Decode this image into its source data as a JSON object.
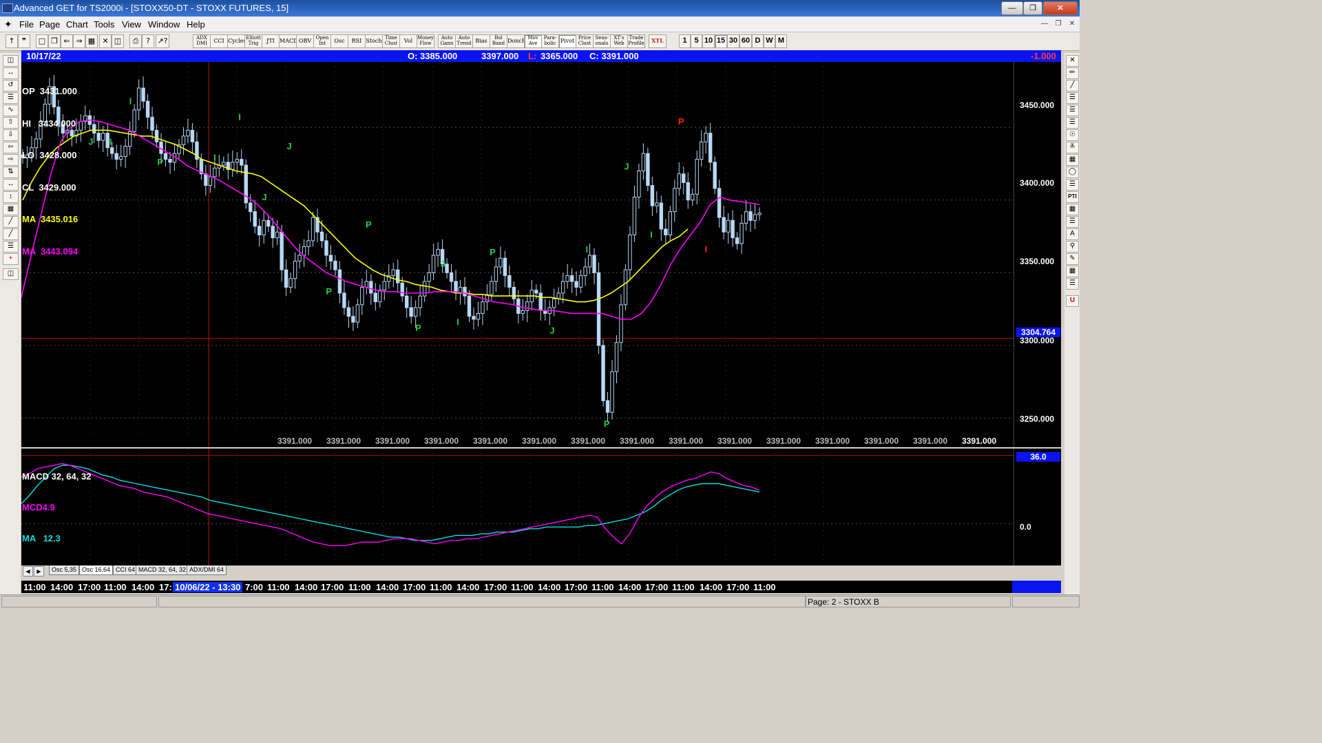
{
  "window": {
    "title": "Advanced GET for TS2000i - [STOXX50-DT - STOXX FUTURES, 15]"
  },
  "menu": [
    "File",
    "Page",
    "Chart",
    "Tools",
    "View",
    "Window",
    "Help"
  ],
  "toolbar": {
    "studies": [
      [
        "ADX",
        "DMI"
      ],
      [
        "CCI"
      ],
      [
        "Cycles"
      ],
      [
        "Elliott",
        "Trig"
      ],
      [
        "JTI"
      ],
      [
        "MACD"
      ],
      [
        "OBV"
      ],
      [
        "Open",
        "Int"
      ],
      [
        "Osc"
      ],
      [
        "RSI"
      ],
      [
        "Stoch"
      ],
      [
        "Time",
        "Clust"
      ],
      [
        "Vol"
      ],
      [
        "Money",
        "Flow"
      ],
      [
        "Auto",
        "Gann"
      ],
      [
        "Auto",
        "Trend"
      ],
      [
        "Bias"
      ],
      [
        "Bol",
        "Band"
      ],
      [
        "Donch"
      ],
      [
        "Mov",
        "Ave"
      ],
      [
        "Para-",
        "bolic"
      ],
      [
        "Pivot"
      ],
      [
        "Price",
        "Clust"
      ],
      [
        "Seas-",
        "onals"
      ],
      [
        "XT's",
        "Web"
      ],
      [
        "Trade",
        "Profile"
      ],
      [
        "XTL"
      ]
    ],
    "periods": [
      "1",
      "5",
      "10",
      "15",
      "30",
      "60",
      "D",
      "W",
      "M"
    ],
    "selected_period": "15"
  },
  "bar": {
    "date": "10/17/22",
    "open": "O: 3385.000",
    "high": "3397.000",
    "low_label": "L:",
    "low": "3365.000",
    "close": "C: 3391.000",
    "change": "-1.000"
  },
  "legend": {
    "op": "OP  3431.000",
    "hi": "HI   3434.000",
    "lo": "LO  3428.000",
    "cl": "CL  3429.000",
    "ma1": "MA  3435.016",
    "ma2": "MA  3443.094",
    "ma1_color": "#ffff00",
    "ma2_color": "#ff00ff"
  },
  "price_axis": [
    "3450.000",
    "3400.000",
    "3350.000",
    "3300.000",
    "3250.000"
  ],
  "crosshair_price": "3304.764",
  "flat_label": "3391.000",
  "macd": {
    "title": "MACD 32, 64, 32",
    "mcd": "MCD4.9",
    "ma": "MA   12.3",
    "axis_top": "36.0",
    "axis_zero": "0.0",
    "mcd_color": "#ff00ff",
    "ma_color": "#00e0e0"
  },
  "tabs": [
    "Osc 5,35",
    "Osc 16,64",
    "CCI 64",
    "MACD 32, 64, 32",
    "ADX/DMI 64"
  ],
  "active_tab": "Osc 16,64",
  "time_axis": {
    "current": "10/06/22 - 13:30"
  },
  "time_labels": [
    "11:00",
    "14:00",
    "17:00",
    "11:00",
    "14:00",
    "17:",
    "7:00",
    "11:00",
    "14:00",
    "17:00",
    "11:00",
    "14:00",
    "17:00",
    "11:00",
    "14:00",
    "17:00",
    "11:00",
    "14:00",
    "17:00",
    "11:00",
    "14:00",
    "17:00",
    "11:00",
    "14:00",
    "17:00",
    "11:00"
  ],
  "status": "Page: 2 - STOXX B",
  "chart_data": {
    "type": "candlestick",
    "ylim": [
      3230,
      3495
    ],
    "price_ticks": [
      3450,
      3400,
      3350,
      3300,
      3250
    ],
    "crosshair": 3304.764,
    "close_series": [
      3429,
      3431,
      3436,
      3442,
      3454,
      3466,
      3478,
      3464,
      3452,
      3446,
      3448,
      3444,
      3448,
      3454,
      3458,
      3452,
      3446,
      3441,
      3446,
      3436,
      3432,
      3428,
      3430,
      3437,
      3447,
      3462,
      3477,
      3468,
      3457,
      3448,
      3440,
      3432,
      3428,
      3426,
      3432,
      3438,
      3444,
      3448,
      3440,
      3428,
      3418,
      3410,
      3416,
      3422,
      3424,
      3426,
      3421,
      3426,
      3428,
      3424,
      3398,
      3392,
      3382,
      3376,
      3386,
      3382,
      3374,
      3378,
      3352,
      3340,
      3346,
      3358,
      3362,
      3368,
      3372,
      3388,
      3378,
      3372,
      3362,
      3358,
      3352,
      3336,
      3326,
      3320,
      3316,
      3328,
      3340,
      3344,
      3336,
      3330,
      3338,
      3344,
      3348,
      3352,
      3343,
      3334,
      3326,
      3320,
      3326,
      3334,
      3344,
      3350,
      3362,
      3366,
      3356,
      3350,
      3344,
      3336,
      3340,
      3334,
      3320,
      3318,
      3322,
      3330,
      3335,
      3344,
      3354,
      3360,
      3348,
      3340,
      3332,
      3322,
      3324,
      3330,
      3338,
      3336,
      3324,
      3322,
      3326,
      3332,
      3336,
      3344,
      3348,
      3344,
      3340,
      3348,
      3354,
      3362,
      3350,
      3300,
      3262,
      3254,
      3282,
      3302,
      3328,
      3352,
      3376,
      3402,
      3420,
      3432,
      3410,
      3396,
      3398,
      3380,
      3376,
      3392,
      3408,
      3418,
      3412,
      3400,
      3404,
      3428,
      3440,
      3446,
      3426,
      3408,
      3388,
      3378,
      3386,
      3374,
      3370,
      3384,
      3392,
      3386,
      3390,
      3391
    ],
    "ma_fast": [
      3400,
      3412,
      3422,
      3430,
      3436,
      3440,
      3444,
      3446,
      3448,
      3448,
      3448,
      3447,
      3446,
      3445,
      3444,
      3444,
      3442,
      3440,
      3438,
      3435,
      3432,
      3428,
      3426,
      3424,
      3422,
      3420,
      3419,
      3418,
      3416,
      3412,
      3408,
      3404,
      3400,
      3396,
      3390,
      3384,
      3378,
      3372,
      3366,
      3360,
      3356,
      3352,
      3349,
      3347,
      3345,
      3344,
      3342,
      3341,
      3340,
      3338,
      3337,
      3336,
      3336,
      3335,
      3335,
      3334,
      3334,
      3334,
      3334,
      3334,
      3334,
      3333,
      3333,
      3332,
      3331,
      3330,
      3330,
      3331,
      3333,
      3336,
      3340,
      3344,
      3350,
      3356,
      3362,
      3368,
      3372,
      3375,
      3380
    ],
    "ma_slow": [
      3333,
      3362,
      3390,
      3418,
      3440,
      3450,
      3454,
      3455,
      3454,
      3452,
      3450,
      3448,
      3444,
      3440,
      3436,
      3432,
      3428,
      3423,
      3420,
      3417,
      3414,
      3410,
      3406,
      3402,
      3397,
      3390,
      3382,
      3374,
      3366,
      3360,
      3355,
      3350,
      3347,
      3344,
      3342,
      3340,
      3338,
      3337,
      3337,
      3336,
      3336,
      3336,
      3337,
      3337,
      3337,
      3336,
      3334,
      3332,
      3330,
      3329,
      3328,
      3326,
      3325,
      3324,
      3324,
      3323,
      3322,
      3322,
      3322,
      3322,
      3320,
      3318,
      3318,
      3322,
      3330,
      3342,
      3356,
      3367,
      3376,
      3385,
      3397,
      3402,
      3400,
      3399,
      3398,
      3397
    ],
    "ma_fast_color": "#ffff00",
    "ma_slow_color": "#ff00ff",
    "price_color": "#b8d8f5",
    "markers": [
      {
        "label": "J",
        "price": 3438,
        "pos": 0.07,
        "color": "#22cc44"
      },
      {
        "label": "I",
        "price": 3438,
        "pos": 0.09,
        "color": "#22cc44"
      },
      {
        "label": "I",
        "price": 3466,
        "pos": 0.11,
        "color": "#22cc44"
      },
      {
        "label": "P",
        "price": 3424,
        "pos": 0.14,
        "color": "#22cc44"
      },
      {
        "label": "I",
        "price": 3427,
        "pos": 0.195,
        "color": "#22cc44"
      },
      {
        "label": "I",
        "price": 3455,
        "pos": 0.22,
        "color": "#22cc44"
      },
      {
        "label": "J",
        "price": 3400,
        "pos": 0.245,
        "color": "#22cc44"
      },
      {
        "label": "J",
        "price": 3435,
        "pos": 0.27,
        "color": "#22cc44"
      },
      {
        "label": "P",
        "price": 3335,
        "pos": 0.31,
        "color": "#22cc44"
      },
      {
        "label": "P",
        "price": 3381,
        "pos": 0.35,
        "color": "#22cc44"
      },
      {
        "label": "P",
        "price": 3310,
        "pos": 0.4,
        "color": "#22cc44"
      },
      {
        "label": "J",
        "price": 3354,
        "pos": 0.425,
        "color": "#22cc44"
      },
      {
        "label": "I",
        "price": 3314,
        "pos": 0.44,
        "color": "#22cc44"
      },
      {
        "label": "P",
        "price": 3362,
        "pos": 0.475,
        "color": "#22cc44"
      },
      {
        "label": "J",
        "price": 3308,
        "pos": 0.535,
        "color": "#22cc44"
      },
      {
        "label": "I",
        "price": 3364,
        "pos": 0.57,
        "color": "#22cc44"
      },
      {
        "label": "P",
        "price": 3244,
        "pos": 0.59,
        "color": "#22cc44"
      },
      {
        "label": "J",
        "price": 3421,
        "pos": 0.61,
        "color": "#22cc44"
      },
      {
        "label": "I",
        "price": 3374,
        "pos": 0.635,
        "color": "#22cc44"
      },
      {
        "label": "P",
        "price": 3452,
        "pos": 0.665,
        "color": "#ff2020"
      },
      {
        "label": "I",
        "price": 3364,
        "pos": 0.69,
        "color": "#ff2020"
      }
    ],
    "macd_ylim": [
      -25,
      45
    ],
    "macd_line": [
      28,
      30,
      33,
      34,
      35,
      36,
      35,
      33,
      31,
      29,
      27,
      25,
      23,
      22,
      21,
      19,
      18,
      17,
      16,
      14,
      12,
      10,
      8,
      6,
      5,
      4,
      3,
      2,
      1,
      0,
      -1,
      -2,
      -3,
      -5,
      -7,
      -9,
      -11,
      -12,
      -13,
      -13,
      -13,
      -12,
      -11,
      -11,
      -11,
      -10,
      -9,
      -9,
      -9,
      -10,
      -11,
      -12,
      -11,
      -10,
      -10,
      -9,
      -9,
      -8,
      -7,
      -6,
      -5,
      -4,
      -3,
      -2,
      -1,
      0,
      1,
      2,
      3,
      4,
      5,
      4,
      -3,
      -8,
      -12,
      -6,
      3,
      10,
      15,
      19,
      22,
      24,
      26,
      27,
      29,
      31,
      30,
      27,
      25,
      23,
      22,
      20
    ],
    "macd_signal": [
      12,
      17,
      23,
      28,
      33,
      35,
      35,
      34,
      33,
      31,
      29,
      28,
      26,
      25,
      24,
      23,
      22,
      21,
      20,
      19,
      18,
      17,
      16,
      14,
      13,
      12,
      11,
      10,
      9,
      8,
      7,
      6,
      5,
      4,
      3,
      2,
      1,
      0,
      -1,
      -2,
      -3,
      -4,
      -5,
      -6,
      -7,
      -8,
      -8,
      -9,
      -10,
      -10,
      -10,
      -9,
      -8,
      -7,
      -7,
      -7,
      -6,
      -6,
      -5,
      -5,
      -5,
      -4,
      -3,
      -3,
      -2,
      -2,
      -2,
      -2,
      -2,
      -1,
      -1,
      0,
      1,
      2,
      3,
      5,
      7,
      10,
      14,
      17,
      20,
      22,
      23,
      24,
      24,
      24,
      23,
      22,
      21,
      20,
      19
    ]
  }
}
